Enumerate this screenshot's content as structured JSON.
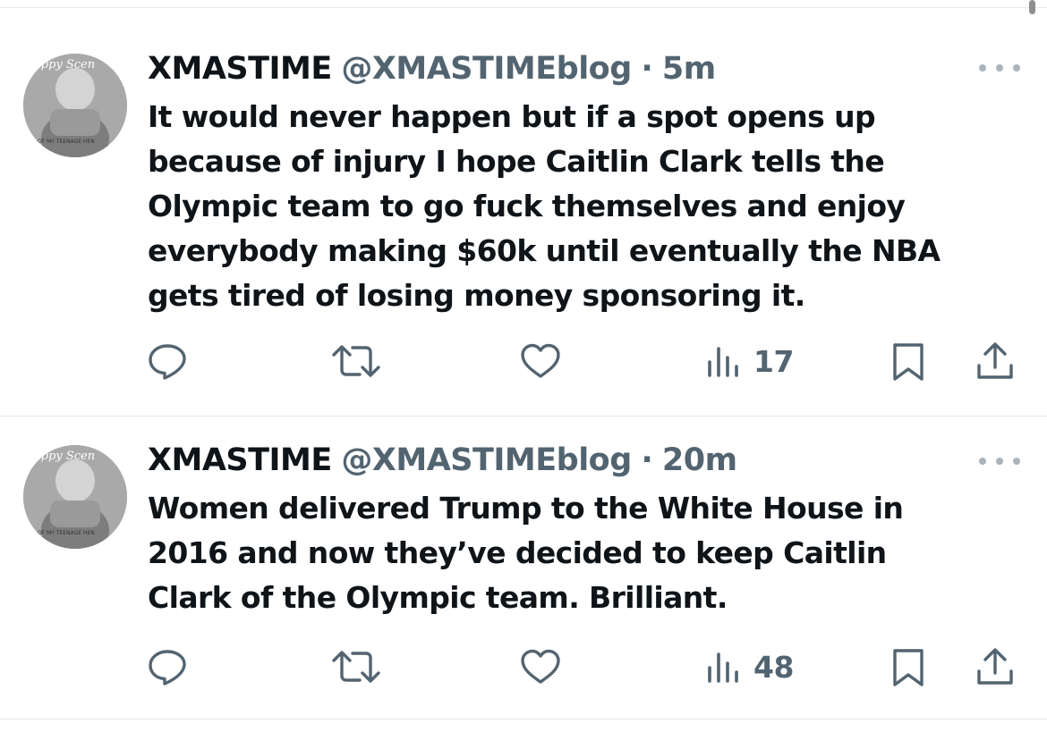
{
  "tweets": [
    {
      "display_name": "XMASTIME",
      "handle": "@XMASTIMEblog",
      "separator": "·",
      "time": "5m",
      "avatar_icon": "profile-photo",
      "text_lines": [
        "It would never happen but if a spot opens up",
        "because of injury I hope Caitlin Clark tells the",
        "Olympic team to go fuck themselves and enjoy",
        "everybody making $60k until eventually the NBA",
        "gets tired of losing money sponsoring it."
      ],
      "views": "17",
      "more_icon": "more-horizontal-icon"
    },
    {
      "display_name": "XMASTIME",
      "handle": "@XMASTIMEblog",
      "separator": "·",
      "time": "20m",
      "avatar_icon": "profile-photo",
      "text_lines": [
        "Women delivered Trump to the White House in",
        "2016 and now they’ve decided to keep Caitlin",
        "Clark of the Olympic team. Brilliant."
      ],
      "views": "48",
      "more_icon": "more-horizontal-icon"
    }
  ],
  "icons": {
    "reply": "reply-icon",
    "retweet": "retweet-icon",
    "like": "heart-icon",
    "views": "views-icon",
    "bookmark": "bookmark-icon",
    "share": "share-icon"
  },
  "colors": {
    "text": "#0f1419",
    "secondary": "#536471",
    "divider": "#e6e8ea"
  }
}
